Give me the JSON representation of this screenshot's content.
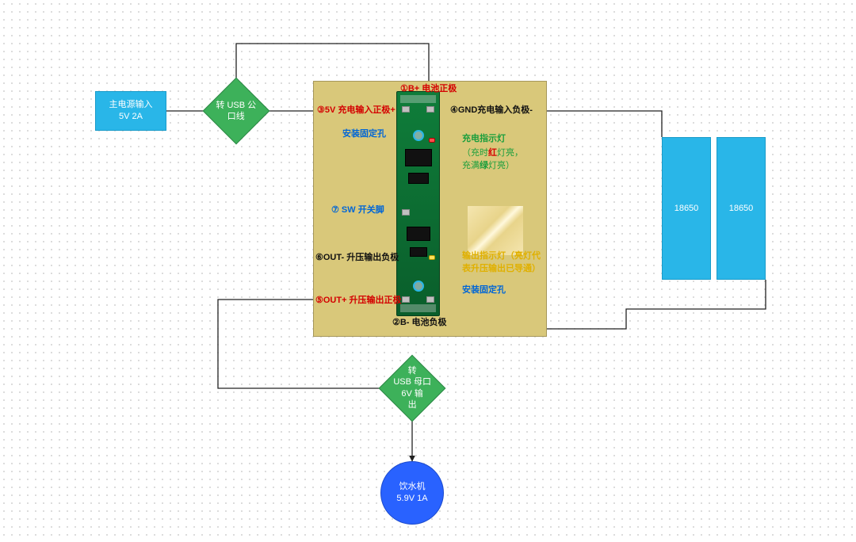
{
  "nodes": {
    "power_in": {
      "line1": "主电源输入",
      "line2": "5V 2A"
    },
    "usb_male": "转 USB 公口线",
    "usb_female": {
      "line1": "转",
      "line2": "USB 母口",
      "line3": "6V 输",
      "line4": "出"
    },
    "dispenser": {
      "line1": "饮水机",
      "line2": "5.9V 1A"
    },
    "bat1": "18650",
    "bat2": "18650"
  },
  "labels": {
    "bplus": "①B+ 电池正极",
    "bminus": "②B- 电池负极",
    "vin": "③5V 充电输入正极+",
    "gnd": "④GND充电输入负极-",
    "outplus": "⑤OUT+ 升压输出正极",
    "outminus": "⑥OUT- 升压输出负极",
    "sw": "⑦ SW 开关脚",
    "mhole_top": "安装固定孔",
    "mhole_bot": "安装固定孔",
    "chg_led": "充电指示灯",
    "chg_led_note": {
      "p1": "（充时",
      "red": "红",
      "p2": "灯亮，",
      "p3": "充满",
      "green": "绿",
      "p4": "灯亮）"
    },
    "out_led": {
      "l1": "输出指示灯（亮灯代",
      "l2": "表升压输出已导通）"
    }
  }
}
